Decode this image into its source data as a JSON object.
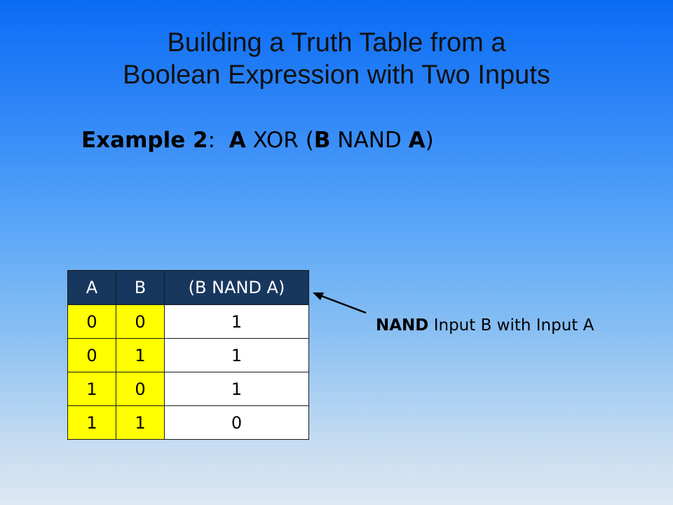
{
  "title": {
    "line1": "Building a Truth Table from a",
    "line2": "Boolean Expression with Two Inputs"
  },
  "example": {
    "label": "Example 2",
    "colon": ":",
    "var_a": "A",
    "op_xor": "XOR (",
    "var_b": "B",
    "op_nand": "NAND",
    "var_a2": "A",
    "close": ")"
  },
  "table": {
    "headers": [
      "A",
      "B",
      "(B NAND A)"
    ],
    "rows": [
      [
        "0",
        "0",
        "1"
      ],
      [
        "0",
        "1",
        "1"
      ],
      [
        "1",
        "0",
        "1"
      ],
      [
        "1",
        "1",
        "0"
      ]
    ]
  },
  "annotation": {
    "bold": "NAND",
    "rest": "Input B with Input A"
  },
  "colors": {
    "header_bg": "#17375e",
    "input_cell_bg": "#ffff00",
    "output_cell_bg": "#ffffff"
  }
}
